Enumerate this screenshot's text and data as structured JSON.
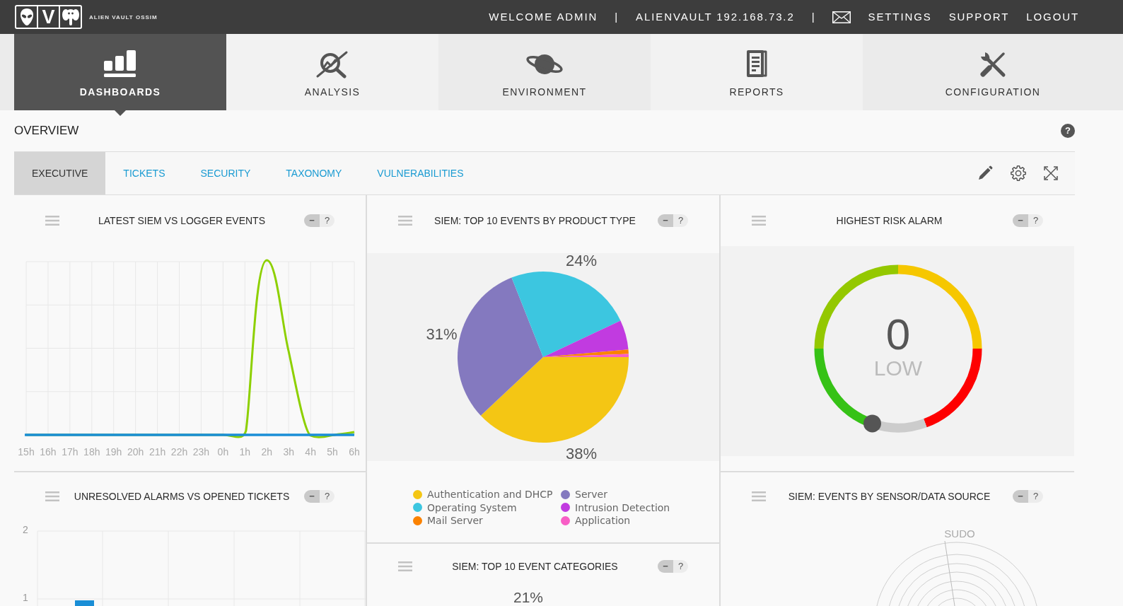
{
  "topbar": {
    "logo": {
      "letter": "V",
      "wordmark": "ALIEN VAULT OSSIM"
    },
    "menu": [
      {
        "kind": "text",
        "label": "WELCOME ADMIN"
      },
      {
        "kind": "separator",
        "label": "|"
      },
      {
        "kind": "text",
        "label": "ALIENVAULT 192.168.73.2"
      },
      {
        "kind": "separator",
        "label": "|"
      },
      {
        "kind": "icon"
      },
      {
        "kind": "link",
        "label": "SETTINGS"
      },
      {
        "kind": "link",
        "label": "SUPPORT"
      },
      {
        "kind": "link",
        "label": "LOGOUT"
      }
    ]
  },
  "nav": {
    "tabs": [
      {
        "label": "DASHBOARDS",
        "selected": true
      },
      {
        "label": "ANALYSIS",
        "selected": false
      },
      {
        "label": "ENVIRONMENT",
        "selected": false
      },
      {
        "label": "REPORTS",
        "selected": false
      },
      {
        "label": "CONFIGURATION",
        "selected": false
      }
    ]
  },
  "overview": {
    "title": "OVERVIEW",
    "help": "?",
    "tabs": [
      {
        "label": "EXECUTIVE",
        "selected": true
      },
      {
        "label": "TICKETS",
        "selected": false
      },
      {
        "label": "SECURITY",
        "selected": false
      },
      {
        "label": "TAXONOMY",
        "selected": false
      },
      {
        "label": "VULNERABILITIES",
        "selected": false
      }
    ]
  },
  "columns": [
    {
      "widgets": [
        {
          "kind": "line",
          "title": "LATEST SIEM VS LOGGER EVENTS",
          "collapse": "−",
          "help": "?",
          "x_labels": [
            "15h",
            "16h",
            "17h",
            "18h",
            "19h",
            "20h",
            "21h",
            "22h",
            "23h",
            "0h",
            "1h",
            "2h",
            "3h",
            "4h",
            "5h",
            "6h"
          ]
        },
        {
          "kind": "bar",
          "title": "UNRESOLVED ALARMS VS OPENED TICKETS",
          "collapse": "−",
          "help": "?",
          "y_labels": [
            "2",
            "1"
          ]
        }
      ]
    },
    {
      "widgets": [
        {
          "kind": "pie",
          "title": "SIEM: TOP 10 EVENTS BY PRODUCT TYPE",
          "collapse": "−",
          "help": "?",
          "chart_data": {
            "type": "pie",
            "categories": [
              "Authentication and DHCP",
              "Server",
              "Operating System",
              "Intrusion Detection",
              "Mail Server",
              "Application"
            ],
            "values": [
              38,
              31,
              24,
              5.6,
              0.8,
              0.6
            ],
            "colors": [
              "#f4c614",
              "#8479bf",
              "#3cc6e0",
              "#c13be0",
              "#fb8200",
              "#f85ec6"
            ],
            "value_labels": [
              "38%",
              "31%",
              "24%",
              null,
              null,
              null
            ],
            "legend": "bottom"
          }
        },
        {
          "kind": "cut",
          "title": "SIEM: TOP 10 EVENT CATEGORIES",
          "collapse": "−",
          "help": "?",
          "label": "21%"
        }
      ]
    },
    {
      "widgets": [
        {
          "kind": "gauge",
          "title": "HIGHEST RISK ALARM",
          "collapse": "−",
          "help": "?",
          "value": "0",
          "rating": "LOW",
          "level": 0
        },
        {
          "kind": "radar",
          "title": "SIEM: EVENTS BY SENSOR/DATA SOURCE",
          "collapse": "−",
          "help": "?",
          "axis_labels": [
            "SUDO"
          ]
        }
      ]
    }
  ]
}
